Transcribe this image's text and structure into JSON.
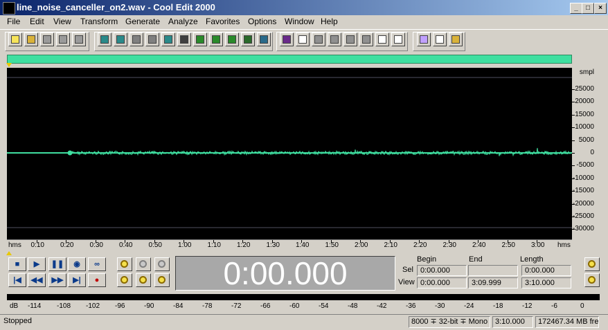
{
  "window": {
    "title": "line_noise_canceller_on2.wav - Cool Edit 2000",
    "min_label": "_",
    "max_label": "□",
    "close_label": "×"
  },
  "menu": [
    "File",
    "Edit",
    "View",
    "Transform",
    "Generate",
    "Analyze",
    "Favorites",
    "Options",
    "Window",
    "Help"
  ],
  "toolbar_icons": [
    "new-file-icon",
    "open-file-icon",
    "save-icon",
    "save-all-icon",
    "close-file-icon",
    "undo-icon",
    "repeat-icon",
    "cut-unused-icon",
    "copy-to-new-icon",
    "copy-icon",
    "cut-icon",
    "paste-icon",
    "paste-new-icon",
    "paste-mix-icon",
    "spectral-view-icon",
    "run-script-icon",
    "envelope-icon",
    "checkbox-icon",
    "grid-icon",
    "grid2-icon",
    "grid3-icon",
    "grid4-icon",
    "q-icon",
    "p-icon",
    "cd-icon",
    "f-icon",
    "edit-icon",
    "help-icon"
  ],
  "colors": {
    "waveform": "#3fdfa0",
    "background": "#000000",
    "marker": "#e8c800"
  },
  "amplitude_axis": {
    "unit": "smpl",
    "labels": [
      "25000",
      "20000",
      "15000",
      "10000",
      "5000",
      "0",
      "-5000",
      "-10000",
      "-15000",
      "-20000",
      "-25000",
      "-30000"
    ]
  },
  "time_axis": {
    "unit_left": "hms",
    "unit_right": "hms",
    "labels": [
      "0:10",
      "0:20",
      "0:30",
      "0:40",
      "0:50",
      "1:00",
      "1:10",
      "1:20",
      "1:30",
      "1:40",
      "1:50",
      "2:00",
      "2:10",
      "2:20",
      "2:30",
      "2:40",
      "2:50",
      "3:00"
    ]
  },
  "time_display": "0:00.000",
  "selection": {
    "headers": {
      "begin": "Begin",
      "end": "End",
      "length": "Length"
    },
    "sel": {
      "label": "Sel",
      "begin": "0:00.000",
      "end": "",
      "length": "0:00.000"
    },
    "view": {
      "label": "View",
      "begin": "0:00.000",
      "end": "3:09.999",
      "length": "3:10.000"
    }
  },
  "level_meter": {
    "unit": "dB",
    "labels": [
      "-114",
      "-108",
      "-102",
      "-96",
      "-90",
      "-84",
      "-78",
      "-72",
      "-66",
      "-60",
      "-54",
      "-48",
      "-42",
      "-36",
      "-30",
      "-24",
      "-18",
      "-12",
      "-6",
      "0"
    ]
  },
  "status": {
    "state": "Stopped",
    "format": "8000 ∓ 32-bit ∓ Mono",
    "duration": "3:10.000",
    "free": "172467.34 MB fre"
  }
}
